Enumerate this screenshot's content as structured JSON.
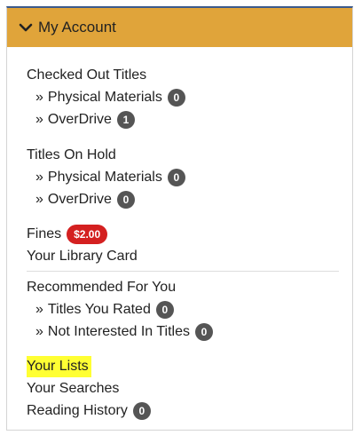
{
  "header": {
    "title": "My Account",
    "icon": "chevron-down-icon",
    "background": "#e0a43a"
  },
  "checked_out": {
    "heading": "Checked Out Titles",
    "items": [
      {
        "label": "Physical Materials",
        "count": "0"
      },
      {
        "label": "OverDrive",
        "count": "1"
      }
    ]
  },
  "on_hold": {
    "heading": "Titles On Hold",
    "items": [
      {
        "label": "Physical Materials",
        "count": "0"
      },
      {
        "label": "OverDrive",
        "count": "0"
      }
    ]
  },
  "fines": {
    "label": "Fines",
    "amount": "$2.00",
    "color": "#d42020"
  },
  "library_card": "Your Library Card",
  "recommended": {
    "heading": "Recommended For You",
    "items": [
      {
        "label": "Titles You Rated",
        "count": "0"
      },
      {
        "label": "Not Interested In Titles",
        "count": "0"
      }
    ]
  },
  "your_lists": {
    "label": "Your Lists",
    "highlight_color": "#ffff33"
  },
  "your_searches": "Your Searches",
  "reading_history": {
    "label": "Reading History",
    "count": "0"
  },
  "sub_prefix": "»"
}
